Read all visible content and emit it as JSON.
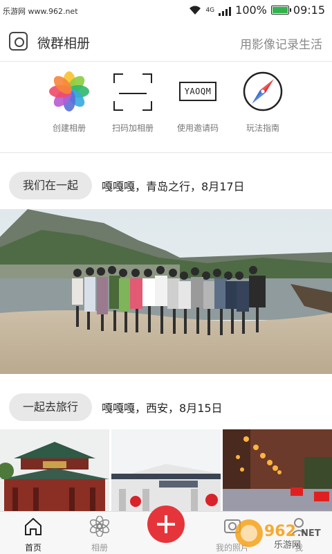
{
  "status": {
    "watermark": "乐游网 www.962.net",
    "battery": "100%",
    "time": "09:15",
    "network": "4G"
  },
  "header": {
    "title": "微群相册",
    "slogan": "用影像记录生活"
  },
  "actions": [
    {
      "label": "创建相册",
      "icon": "photos-icon"
    },
    {
      "label": "扫码加相册",
      "icon": "scan-icon"
    },
    {
      "label": "使用邀请码",
      "icon": "invite-code-icon",
      "code": "YAOQM"
    },
    {
      "label": "玩法指南",
      "icon": "compass-icon"
    }
  ],
  "albums": [
    {
      "tag": "我们在一起",
      "desc": "嘎嘎嘎，青岛之行，8月17日"
    },
    {
      "tag": "一起去旅行",
      "desc": "嘎嘎嘎，西安，8月15日"
    }
  ],
  "tabs": [
    {
      "label": "首页",
      "icon": "home-icon",
      "active": true
    },
    {
      "label": "相册",
      "icon": "flower-icon",
      "active": false
    },
    {
      "label": "我的照片",
      "icon": "my-photos-icon",
      "active": false
    },
    {
      "label": "我",
      "icon": "profile-icon",
      "active": false
    }
  ],
  "brand_watermark": "962.NET 乐游网",
  "colors": {
    "accent": "#e5353b",
    "battery": "#2fb54b"
  }
}
